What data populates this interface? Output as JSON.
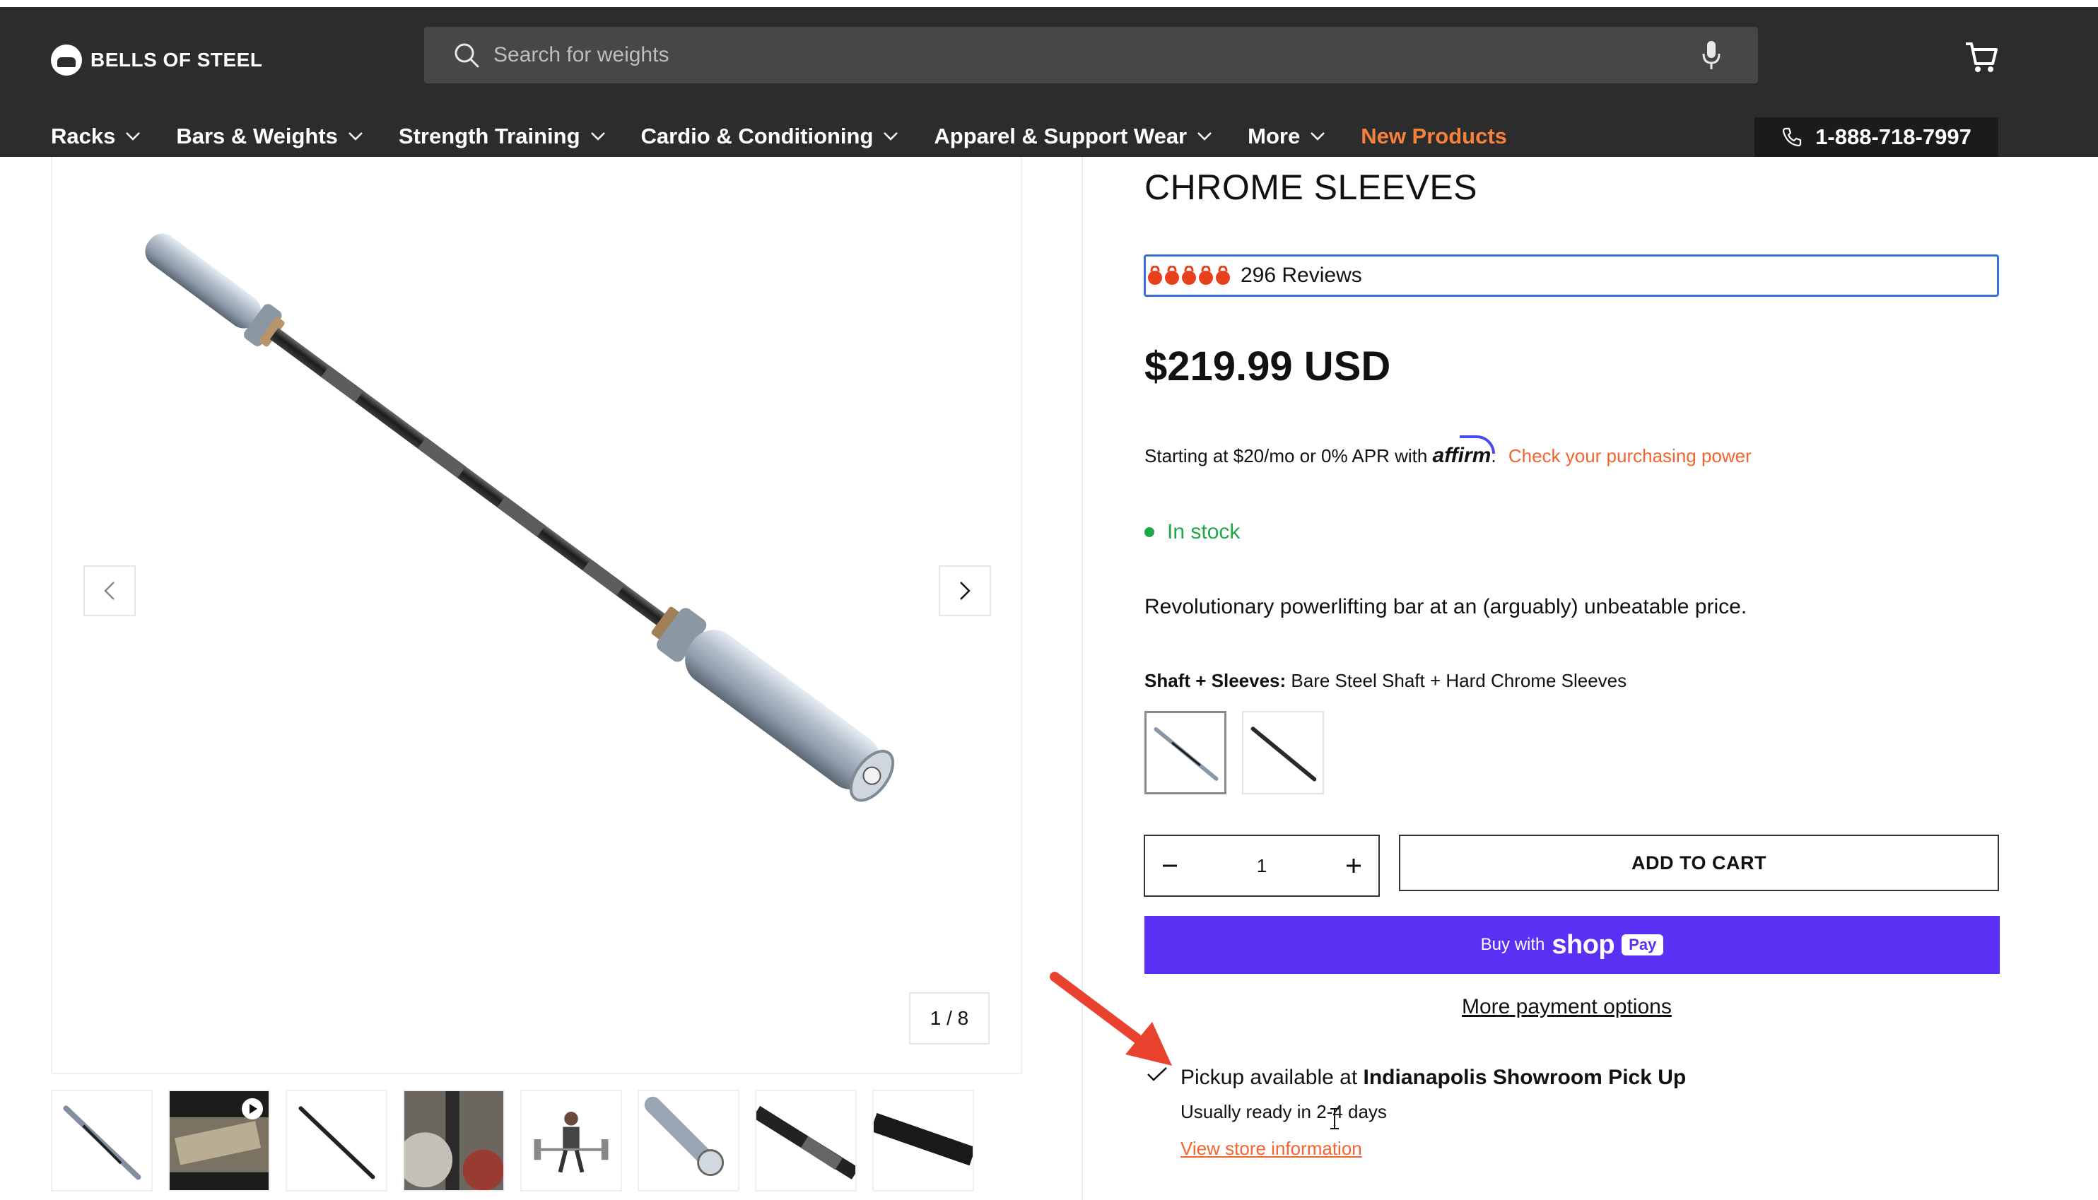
{
  "brand": {
    "name": "BELLS OF STEEL"
  },
  "search": {
    "placeholder": "Search for weights"
  },
  "nav": {
    "items": [
      {
        "label": "Racks"
      },
      {
        "label": "Bars & Weights"
      },
      {
        "label": "Strength Training"
      },
      {
        "label": "Cardio & Conditioning"
      },
      {
        "label": "Apparel & Support Wear"
      },
      {
        "label": "More"
      }
    ],
    "highlight": {
      "label": "New Products"
    },
    "phone": "1-888-718-7997"
  },
  "gallery": {
    "counter": "1 / 8",
    "thumbnails": [
      "bar-silver",
      "video-best-power-bar",
      "bar-black",
      "deadlift-setup",
      "athlete-lifting",
      "sleeve-end",
      "bar-closeup",
      "bar-black-closeup"
    ]
  },
  "product": {
    "title": "CHROME SLEEVES",
    "reviews": "296 Reviews",
    "rating": 5,
    "price": "$219.99 USD",
    "financing": {
      "prefix": "Starting at $20/mo or 0% APR with",
      "provider": "affirm",
      "punct": ".",
      "link": "Check your purchasing power"
    },
    "stock": "In stock",
    "description": "Revolutionary powerlifting bar at an (arguably) unbeatable price.",
    "option": {
      "name": "Shaft + Sleeves:",
      "value": "Bare Steel Shaft + Hard Chrome Sleeves"
    },
    "quantity": "1",
    "add_to_cart": "ADD TO CART",
    "shoppay": {
      "prefix": "Buy with",
      "shop": "shop",
      "pay": "Pay"
    },
    "more_payment": "More payment options",
    "pickup": {
      "prefix": "Pickup available at",
      "location": "Indianapolis Showroom Pick Up",
      "ready": "Usually ready in 2-4 days",
      "link": "View store information"
    }
  },
  "colors": {
    "header_bg": "#2c2c2c",
    "accent_orange": "#f5813b",
    "link_orange": "#f1642f",
    "shoppay_purple": "#5a31f4",
    "stock_green": "#1ea84a",
    "review_outline": "#3a6fd8"
  }
}
